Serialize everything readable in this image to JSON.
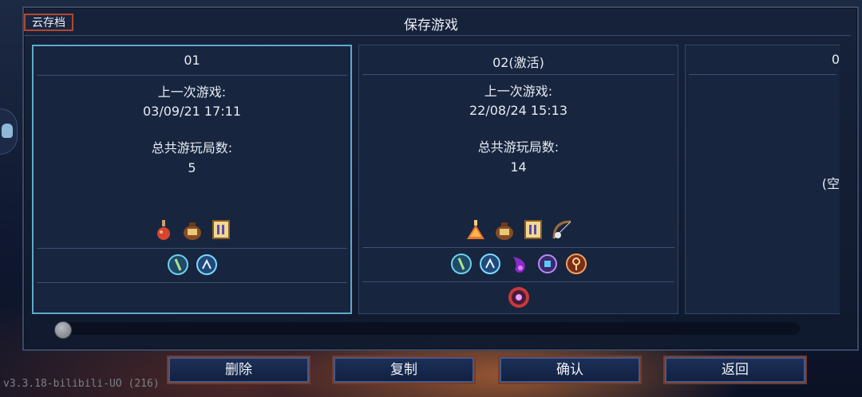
{
  "header": {
    "cloud_label": "云存档",
    "title": "保存游戏"
  },
  "slots": [
    {
      "name": "01",
      "last_label": "上一次游戏:",
      "last_date": "03/09/21 17:11",
      "runs_label": "总共游玩局数:",
      "runs": "5",
      "icons_row1": [
        "flask-icon",
        "bomb-pot-icon",
        "scroll-icon"
      ],
      "icons_row2": [
        "rune-vine-icon",
        "rune-teleport-icon"
      ],
      "icons_row3": []
    },
    {
      "name": "02(激活)",
      "last_label": "上一次游戏:",
      "last_date": "22/08/24 15:13",
      "runs_label": "总共游玩局数:",
      "runs": "14",
      "icons_row1": [
        "potion-icon",
        "bomb-pot-icon",
        "scroll-icon",
        "bow-icon"
      ],
      "icons_row2": [
        "rune-vine-icon",
        "rune-teleport-icon",
        "purple-flame-icon",
        "gear-rune-icon",
        "key-rune-icon"
      ],
      "icons_row3": [
        "eye-medallion-icon"
      ]
    },
    {
      "name": "0",
      "empty_label": "(空"
    }
  ],
  "buttons": {
    "delete": "删除",
    "copy": "复制",
    "confirm": "确认",
    "back": "返回"
  },
  "version": "v3.3.18-bilibili-UO (216)",
  "colors": {
    "accent_border": "#5fa8cc",
    "cloud_border": "#b2462f",
    "button_glow": "#7a3a24"
  }
}
